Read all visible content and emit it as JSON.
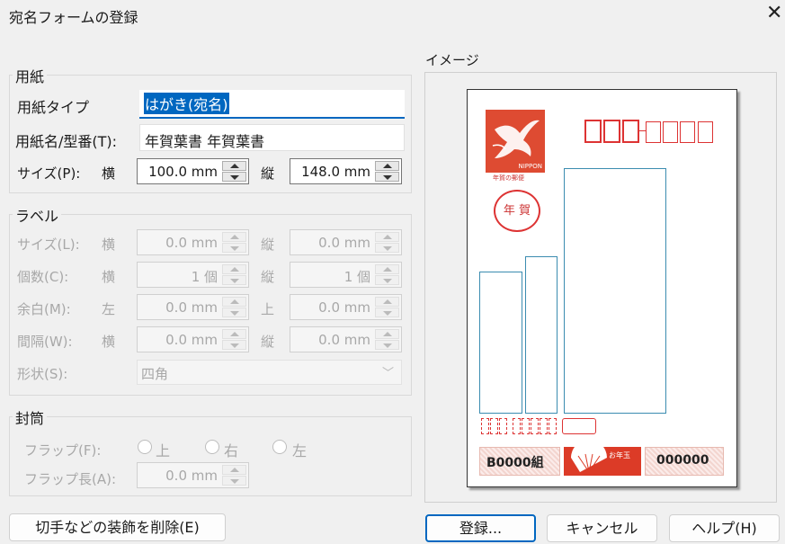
{
  "window": {
    "title": "宛名フォームの登録"
  },
  "paper": {
    "group_label": "用紙",
    "type_label": "用紙タイプ",
    "type_value": "はがき(宛名)",
    "name_label": "用紙名/型番(T):",
    "name_value": "年賀葉書 年賀葉書",
    "size_label": "サイズ(P):",
    "width_label": "横",
    "width_value": "100.0 mm",
    "height_label": "縦",
    "height_value": "148.0 mm"
  },
  "label_section": {
    "group_label": "ラベル",
    "size_label": "サイズ(L):",
    "size_w_label": "横",
    "size_w": "0.0 mm",
    "size_h_label": "縦",
    "size_h": "0.0 mm",
    "count_label": "個数(C):",
    "count_w_label": "横",
    "count_w": "1 個",
    "count_h_label": "縦",
    "count_h": "1 個",
    "margin_label": "余白(M):",
    "margin_left_label": "左",
    "margin_left": "0.0 mm",
    "margin_top_label": "上",
    "margin_top": "0.0 mm",
    "gap_label": "間隔(W):",
    "gap_w_label": "横",
    "gap_w": "0.0 mm",
    "gap_h_label": "縦",
    "gap_h": "0.0 mm",
    "shape_label": "形状(S):",
    "shape_value": "四角"
  },
  "envelope": {
    "group_label": "封筒",
    "flap_label": "フラップ(F):",
    "flap_options": [
      "上",
      "右",
      "左"
    ],
    "flap_length_label": "フラップ長(A):",
    "flap_length_value": "0.0 mm"
  },
  "preview": {
    "label": "イメージ",
    "stamp_text": "NIPPON",
    "stamp_caption": "年賀の郵便",
    "postmark_text": "年 賀",
    "lottery_group": "B0000組",
    "lottery_badge": "お年玉",
    "lottery_number": "000000"
  },
  "buttons": {
    "remove_decoration": "切手などの装飾を削除(E)",
    "register": "登録...",
    "cancel": "キャンセル",
    "help": "ヘルプ(H)"
  },
  "colors": {
    "accent": "#0067c0",
    "card_red": "#d83a2a",
    "address_blue": "#3b8cb0"
  }
}
